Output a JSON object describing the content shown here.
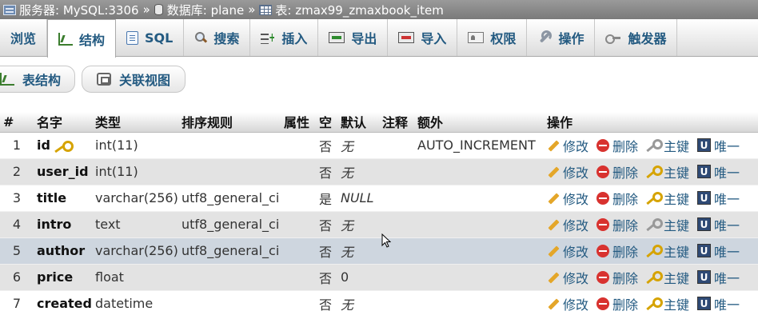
{
  "breadcrumb": {
    "server": "服务器: MySQL:3306",
    "database": "数据库: plane",
    "table": "表: zmax99_zmaxbook_item",
    "separator": "»"
  },
  "tabs": [
    {
      "label": "浏览",
      "icon": "browse-icon",
      "active": false
    },
    {
      "label": "结构",
      "icon": "structure-icon",
      "active": true
    },
    {
      "label": "SQL",
      "icon": "sql-icon",
      "active": false
    },
    {
      "label": "搜索",
      "icon": "search-icon",
      "active": false
    },
    {
      "label": "插入",
      "icon": "insert-icon",
      "active": false
    },
    {
      "label": "导出",
      "icon": "export-icon",
      "active": false
    },
    {
      "label": "导入",
      "icon": "import-icon",
      "active": false
    },
    {
      "label": "权限",
      "icon": "privileges-icon",
      "active": false
    },
    {
      "label": "操作",
      "icon": "wrench-icon",
      "active": false
    },
    {
      "label": "触发器",
      "icon": "trigger-icon",
      "active": false
    }
  ],
  "subtabs": [
    {
      "label": "表结构",
      "icon": "table-structure-icon"
    },
    {
      "label": "关联视图",
      "icon": "relation-view-icon"
    }
  ],
  "columns": [
    "#",
    "名字",
    "类型",
    "排序规则",
    "属性",
    "空",
    "默认",
    "注释",
    "额外",
    "操作"
  ],
  "actions": {
    "edit": "修改",
    "delete": "删除",
    "primary": "主键",
    "unique": "唯一"
  },
  "rows": [
    {
      "num": "1",
      "name": "id",
      "type": "int(11)",
      "collation": "",
      "attributes": "",
      "null": "否",
      "default": "无",
      "comment": "",
      "extra": "AUTO_INCREMENT",
      "is_primary": true
    },
    {
      "num": "2",
      "name": "user_id",
      "type": "int(11)",
      "collation": "",
      "attributes": "",
      "null": "否",
      "default": "无",
      "comment": "",
      "extra": "",
      "is_primary": false
    },
    {
      "num": "3",
      "name": "title",
      "type": "varchar(256)",
      "collation": "utf8_general_ci",
      "attributes": "",
      "null": "是",
      "default": "NULL",
      "comment": "",
      "extra": "",
      "is_primary": false
    },
    {
      "num": "4",
      "name": "intro",
      "type": "text",
      "collation": "utf8_general_ci",
      "attributes": "",
      "null": "否",
      "default": "无",
      "comment": "",
      "extra": "",
      "is_primary": false
    },
    {
      "num": "5",
      "name": "author",
      "type": "varchar(256)",
      "collation": "utf8_general_ci",
      "attributes": "",
      "null": "否",
      "default": "无",
      "comment": "",
      "extra": "",
      "is_primary": false
    },
    {
      "num": "6",
      "name": "price",
      "type": "float",
      "collation": "",
      "attributes": "",
      "null": "否",
      "default": "0",
      "comment": "",
      "extra": "",
      "is_primary": false
    },
    {
      "num": "7",
      "name": "created",
      "type": "datetime",
      "collation": "",
      "attributes": "",
      "null": "否",
      "default": "无",
      "comment": "",
      "extra": "",
      "is_primary": false
    }
  ],
  "colors": {
    "link": "#235a81",
    "row_even": "#e3e3e3",
    "row_hover": "#ced6df",
    "breadcrumb_bg": "#8a8a8a"
  }
}
